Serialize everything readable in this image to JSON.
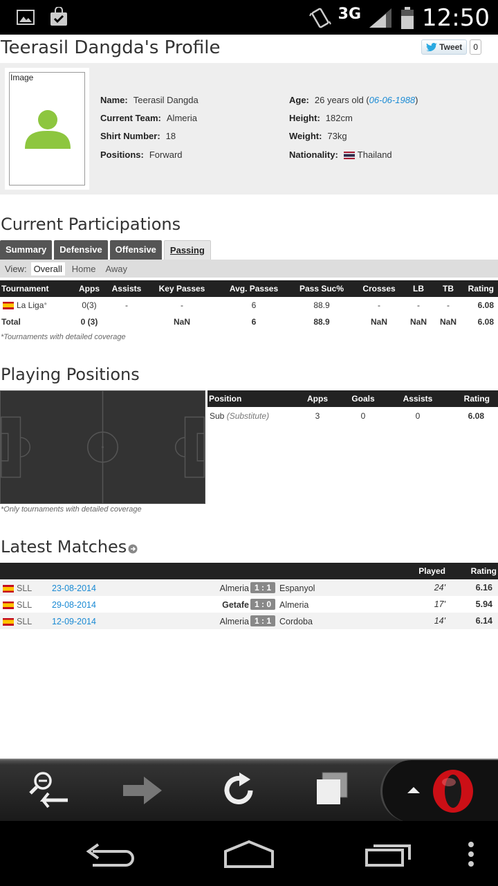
{
  "status_bar": {
    "network": "3G",
    "time": "12:50"
  },
  "page": {
    "title": "Teerasil Dangda's Profile",
    "tweet": {
      "label": "Tweet",
      "count": "0"
    },
    "profile": {
      "image_alt": "Image",
      "fields": {
        "name_label": "Name:",
        "name": "Teerasil Dangda",
        "team_label": "Current Team:",
        "team": "Almeria",
        "shirt_label": "Shirt Number:",
        "shirt": "18",
        "positions_label": "Positions:",
        "positions": "Forward",
        "age_label": "Age:",
        "age": "26 years old (",
        "dob": "06-06-1988",
        "age_close": ")",
        "height_label": "Height:",
        "height": "182cm",
        "weight_label": "Weight:",
        "weight": "73kg",
        "nationality_label": "Nationality:",
        "nationality": "Thailand"
      }
    },
    "participations": {
      "heading": "Current Participations",
      "tabs": [
        "Summary",
        "Defensive",
        "Offensive",
        "Passing"
      ],
      "active_tab": "Passing",
      "view_label": "View:",
      "view_options": [
        "Overall",
        "Home",
        "Away"
      ],
      "columns": [
        "Tournament",
        "Apps",
        "Assists",
        "Key Passes",
        "Avg. Passes",
        "Pass Suc%",
        "Crosses",
        "LB",
        "TB",
        "Rating"
      ],
      "rows": [
        {
          "tournament": "La Liga",
          "marker": "*",
          "apps": "0(3)",
          "assists": "-",
          "key_passes": "-",
          "avg_passes": "6",
          "pass_suc": "88.9",
          "crosses": "-",
          "lb": "-",
          "tb": "-",
          "rating": "6.08"
        },
        {
          "tournament": "Total",
          "apps": "0 (3)",
          "assists": "",
          "key_passes": "NaN",
          "avg_passes": "6",
          "pass_suc": "88.9",
          "crosses": "NaN",
          "lb": "NaN",
          "tb": "NaN",
          "rating": "6.08"
        }
      ],
      "note": "*Tournaments with detailed coverage"
    },
    "positions": {
      "heading": "Playing Positions",
      "columns": [
        "Position",
        "Apps",
        "Goals",
        "Assists",
        "Rating"
      ],
      "rows": [
        {
          "position": "Sub",
          "detail": "(Substitute)",
          "apps": "3",
          "goals": "0",
          "assists": "0",
          "rating": "6.08"
        }
      ],
      "note": "*Only tournaments with detailed coverage"
    },
    "matches": {
      "heading": "Latest Matches",
      "columns": {
        "played": "Played",
        "rating": "Rating"
      },
      "rows": [
        {
          "comp": "SLL",
          "date": "23-08-2014",
          "home": "Almeria",
          "score": "1 : 1",
          "away": "Espanyol",
          "played": "24'",
          "rating": "6.16"
        },
        {
          "comp": "SLL",
          "date": "29-08-2014",
          "home": "Getafe",
          "score": "1 : 0",
          "away": "Almeria",
          "played": "17'",
          "rating": "5.94"
        },
        {
          "comp": "SLL",
          "date": "12-09-2014",
          "home": "Almeria",
          "score": "1 : 1",
          "away": "Cordoba",
          "played": "14'",
          "rating": "6.14"
        }
      ]
    }
  },
  "colors": {
    "accent_rating": "#e8661c",
    "link": "#1a8ad4",
    "header_dark": "#222222",
    "opera_red": "#cc0f16"
  }
}
